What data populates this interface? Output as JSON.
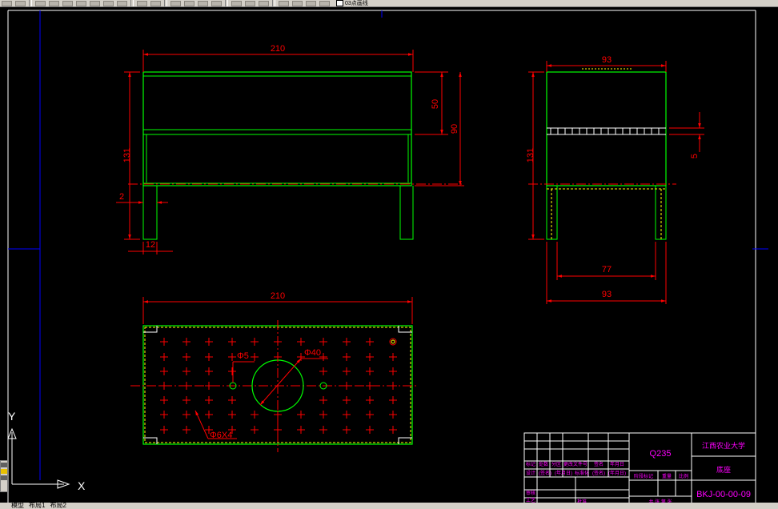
{
  "toolbar": {
    "layer_label": "03点画线",
    "buttons": [
      "new-icon",
      "open-icon",
      "save-icon",
      "print-icon",
      "preview-icon",
      "cut-icon",
      "copy-icon",
      "paste-icon",
      "match-icon",
      "undo-icon",
      "redo-icon",
      "pan-icon",
      "zoom-realtime-icon",
      "zoom-window-icon",
      "zoom-previous-icon",
      "properties-icon",
      "design-center-icon",
      "tool-palette-icon",
      "layer-icon",
      "lightbulb-icon",
      "sun-icon",
      "lock-icon",
      "color-icon"
    ]
  },
  "drawing": {
    "front_view": {
      "dim_width": "210",
      "dim_height": "131",
      "dim_top_part": "50",
      "dim_body": "90",
      "dim_thickness": "2",
      "dim_leg": "12"
    },
    "side_view": {
      "dim_width": "93",
      "dim_height": "131",
      "dim_slot": "5",
      "dim_inner": "77",
      "dim_outer": "93"
    },
    "top_view": {
      "dim_width": "210",
      "dim_small_hole": "Φ5",
      "dim_large_hole": "Φ40",
      "dim_holes": "Φ6X4"
    },
    "title_block": {
      "material": "Q235",
      "school": "江西农业大学",
      "part_name": "底座",
      "drawing_no": "BKJ-00-00-09",
      "row_labels": [
        "标记",
        "处数",
        "分区",
        "更改文件号",
        "签名",
        "年月日"
      ],
      "row_values": [
        "设计",
        "(签名)",
        "(年月日)",
        "标准化",
        "(签名)",
        "(年月日)"
      ],
      "mid_labels": [
        "阶段标记",
        "重量",
        "比例"
      ],
      "bottom_labels": [
        "审核",
        "工艺",
        "批准"
      ],
      "sheet_label": "共  张 第  张"
    }
  },
  "ucs": {
    "y_label": "Y",
    "x_label": "X"
  },
  "tabs": [
    "模型",
    "布局1",
    "布局2"
  ]
}
